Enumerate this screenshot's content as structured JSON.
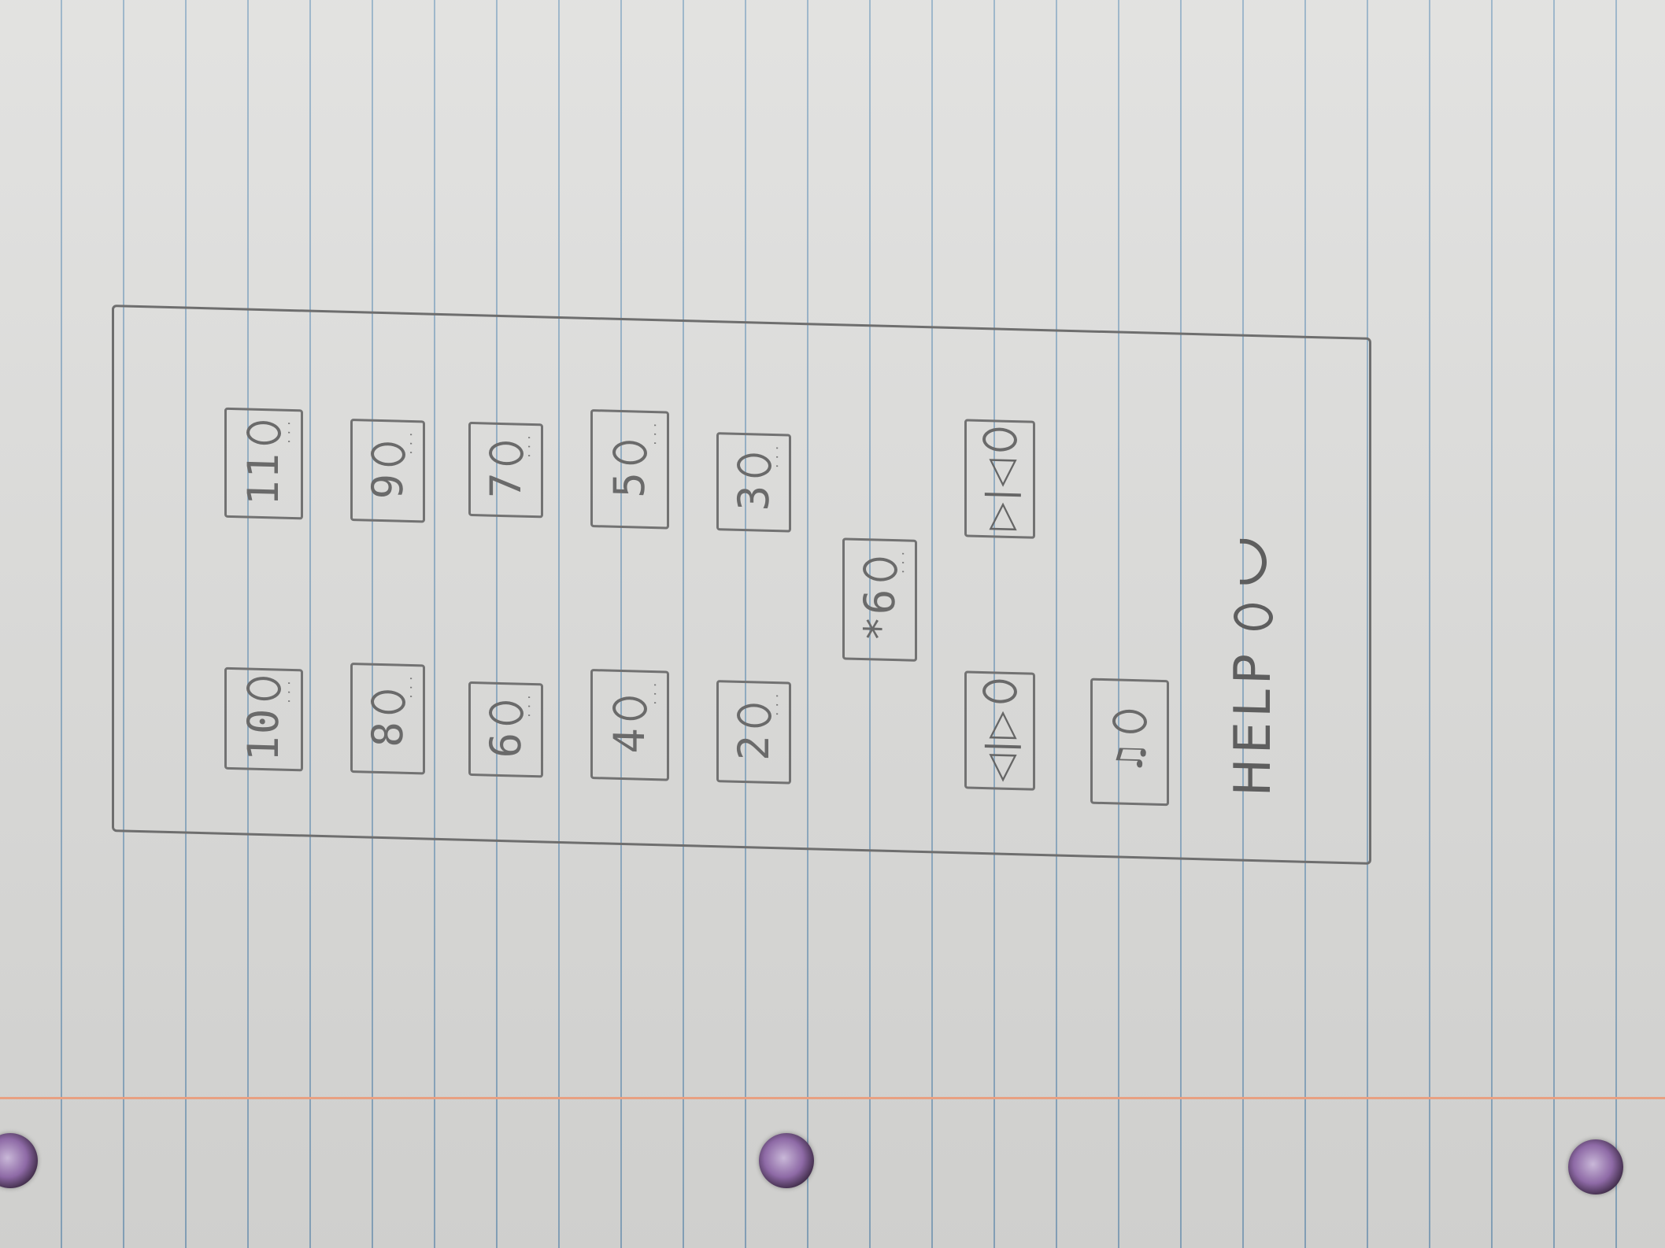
{
  "keypad": {
    "rows": [
      [
        {
          "label": "10",
          "icon": "circle"
        },
        {
          "label": "11",
          "icon": "circle"
        }
      ],
      [
        {
          "label": "8",
          "icon": "circle"
        },
        {
          "label": "9",
          "icon": "circle"
        }
      ],
      [
        {
          "label": "6",
          "icon": "circle"
        },
        {
          "label": "7",
          "icon": "circle"
        }
      ],
      [
        {
          "label": "4",
          "icon": "circle"
        },
        {
          "label": "5",
          "icon": "circle"
        }
      ],
      [
        {
          "label": "2",
          "icon": "circle"
        },
        {
          "label": "3",
          "icon": "circle"
        }
      ]
    ],
    "star_key": {
      "label": "*6",
      "icon": "circle"
    },
    "media": {
      "rewind": {
        "glyph": "◁|▷",
        "icon": "rewind-play-icon"
      },
      "forward": {
        "glyph": "▷|◁",
        "icon": "forward-play-icon"
      }
    },
    "bell_key": {
      "glyph": "♫",
      "icon": "bell-icon"
    },
    "help": {
      "label": "HELP",
      "icon": "phone-icon"
    }
  }
}
